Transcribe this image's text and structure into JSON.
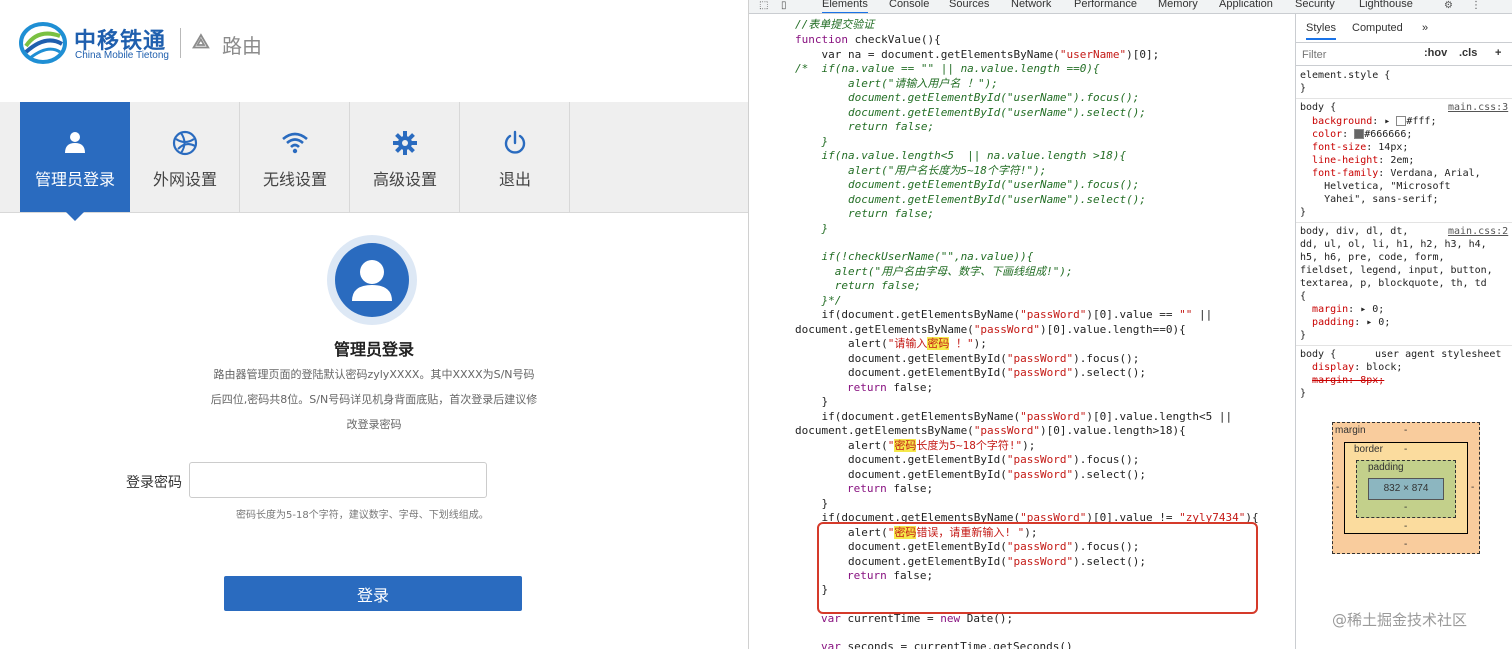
{
  "router": {
    "brand": "中移铁通",
    "brand_sub": "China Mobile Tietong",
    "product": "路由",
    "nav": [
      {
        "label": "管理员登录",
        "icon": "user-icon"
      },
      {
        "label": "外网设置",
        "icon": "globe-icon"
      },
      {
        "label": "无线设置",
        "icon": "wifi-icon"
      },
      {
        "label": "高级设置",
        "icon": "gear-icon"
      },
      {
        "label": "退出",
        "icon": "power-icon"
      }
    ],
    "login_title": "管理员登录",
    "desc_lines": [
      "路由器管理页面的登陆默认密码zylyXXXX。其中XXXX为S/N号码",
      "后四位,密码共8位。S/N号码详见机身背面底贴，首次登录后建议修",
      "改登录密码"
    ],
    "password_label": "登录密码",
    "password_value": "",
    "password_hint": "密码长度为5-18个字符，建议数字、字母、下划线组成。",
    "login_button": "登录",
    "accent_color": "#2a6bbf"
  },
  "devtools": {
    "tabs": [
      "Elements",
      "Console",
      "Sources",
      "Network",
      "Performance",
      "Memory",
      "Application",
      "Security",
      "Lighthouse"
    ],
    "active_tab": "Elements",
    "code": {
      "l1": "//表单提交验证",
      "l2_kw": "function",
      "l2_fn": " checkValue(){",
      "l3a": "    var na = document.getElementsByName(",
      "l3s": "\"userName\"",
      "l3b": ")[0];",
      "l4": "/*  if(na.value == \"\" || na.value.length ==0){",
      "l5": "        alert(\"请输入用户名 ！\");",
      "l6": "        document.getElementById(\"userName\").focus();",
      "l7": "        document.getElementById(\"userName\").select();",
      "l8": "        return false;",
      "l9": "    }",
      "l10": "    if(na.value.length<5  || na.value.length >18){",
      "l11": "        alert(\"用户名长度为5~18个字符!\");",
      "l12": "        document.getElementById(\"userName\").focus();",
      "l13": "        document.getElementById(\"userName\").select();",
      "l14": "        return false;",
      "l15": "    }",
      "l16": "    if(!checkUserName(\"\",na.value)){",
      "l17": "      alert(\"用户名由字母、数字、下画线组成!\");",
      "l18": "      return false;",
      "l19": "    }*/",
      "l20a": "    if(document.getElementsByName(",
      "l20s": "\"passWord\"",
      "l20b": ")[0].value == ",
      "l20c": "\"\"",
      "l20d": " ||",
      "l21a": "document.getElementsByName(",
      "l21s": "\"passWord\"",
      "l21b": ")[0].value.length==0){",
      "l22a": "        alert(",
      "l22s1": "\"请输入",
      "l22h": "密码",
      "l22s2": " ！\"",
      "l22b": ");",
      "l23a": "        document.getElementById(",
      "l23s": "\"passWord\"",
      "l23b": ").focus();",
      "l24a": "        document.getElementById(",
      "l24s": "\"passWord\"",
      "l24b": ").select();",
      "l25k": "return",
      "l25b": " false;",
      "l26": "    }",
      "l27a": "    if(document.getElementsByName(",
      "l27s": "\"passWord\"",
      "l27b": ")[0].value.length<5 ||",
      "l28a": "document.getElementsByName(",
      "l28s": "\"passWord\"",
      "l28b": ")[0].value.length>18){",
      "l29a": "        alert(",
      "l29s1": "\"",
      "l29h": "密码",
      "l29s2": "长度为5~18个字符!\"",
      "l29b": ");",
      "l30a": "        document.getElementById(",
      "l30s": "\"passWord\"",
      "l30b": ").focus();",
      "l31a": "        document.getElementById(",
      "l31s": "\"passWord\"",
      "l31b": ").select();",
      "l32k": "return",
      "l32b": " false;",
      "l33": "    }",
      "l34a": "    if(document.getElementsByName(",
      "l34s": "\"passWord\"",
      "l34b": ")[0].value != ",
      "l34c": "\"zyly7434\"",
      "l34d": "){",
      "l35a": "        alert(",
      "l35s1": "\"",
      "l35h": "密码",
      "l35s2": "错误，请重新输入! \"",
      "l35b": ");",
      "l36a": "        document.getElementById(",
      "l36s": "\"passWord\"",
      "l36b": ").focus();",
      "l37a": "        document.getElementById(",
      "l37s": "\"passWord\"",
      "l37b": ").select();",
      "l38k": "return",
      "l38b": " false;",
      "l39": "    }",
      "l40k": "var",
      "l40b": " currentTime = ",
      "l40k2": "new",
      "l40c": " Date();",
      "l41k": "var",
      "l41b": " seconds = currentTime.getSeconds()"
    },
    "styles": {
      "tabs": [
        "Styles",
        "Computed",
        "»"
      ],
      "filter_placeholder": "Filter",
      "hov": ":hov",
      "cls": ".cls",
      "plus": "+",
      "r1a": "element.style {",
      "r1b": "}",
      "r2sel": "body {",
      "r2src": "main.css:3",
      "r2p1": "background",
      "r2v1": "#fff;",
      "r2p2": "color",
      "r2v2": "#666666;",
      "r2p3": "font-size",
      "r2v3": "14px;",
      "r2p4": "line-height",
      "r2v4": "2em;",
      "r2p5": "font-family",
      "r2v5a": "Verdana, Arial,",
      "r2v5b": "Helvetica, \"Microsoft",
      "r2v5c": "Yahei\", sans-serif;",
      "r2end": "}",
      "r3sel1": "body, div, dl, dt,",
      "r3src": "main.css:2",
      "r3sel2": "dd, ul, ol, li, h1, h2, h3, h4,",
      "r3sel3": "h5, h6, pre, code, form,",
      "r3sel4": "fieldset, legend, input, button,",
      "r3sel5": "textarea, p, blockquote, th, td",
      "r3open": "{",
      "r3p1": "margin",
      "r3v1": "0;",
      "r3p2": "padding",
      "r3v2": "0;",
      "r3end": "}",
      "r4sel": "body {",
      "r4src": "user agent stylesheet",
      "r4p1": "display",
      "r4v1": "block;",
      "r4p2": "margin: 8px;",
      "r4end": "}",
      "bm_margin": "margin",
      "bm_border": "border",
      "bm_padding": "padding",
      "bm_content": "832 × 874",
      "bm_dash": "-"
    }
  },
  "watermark": "@稀土掘金技术社区"
}
